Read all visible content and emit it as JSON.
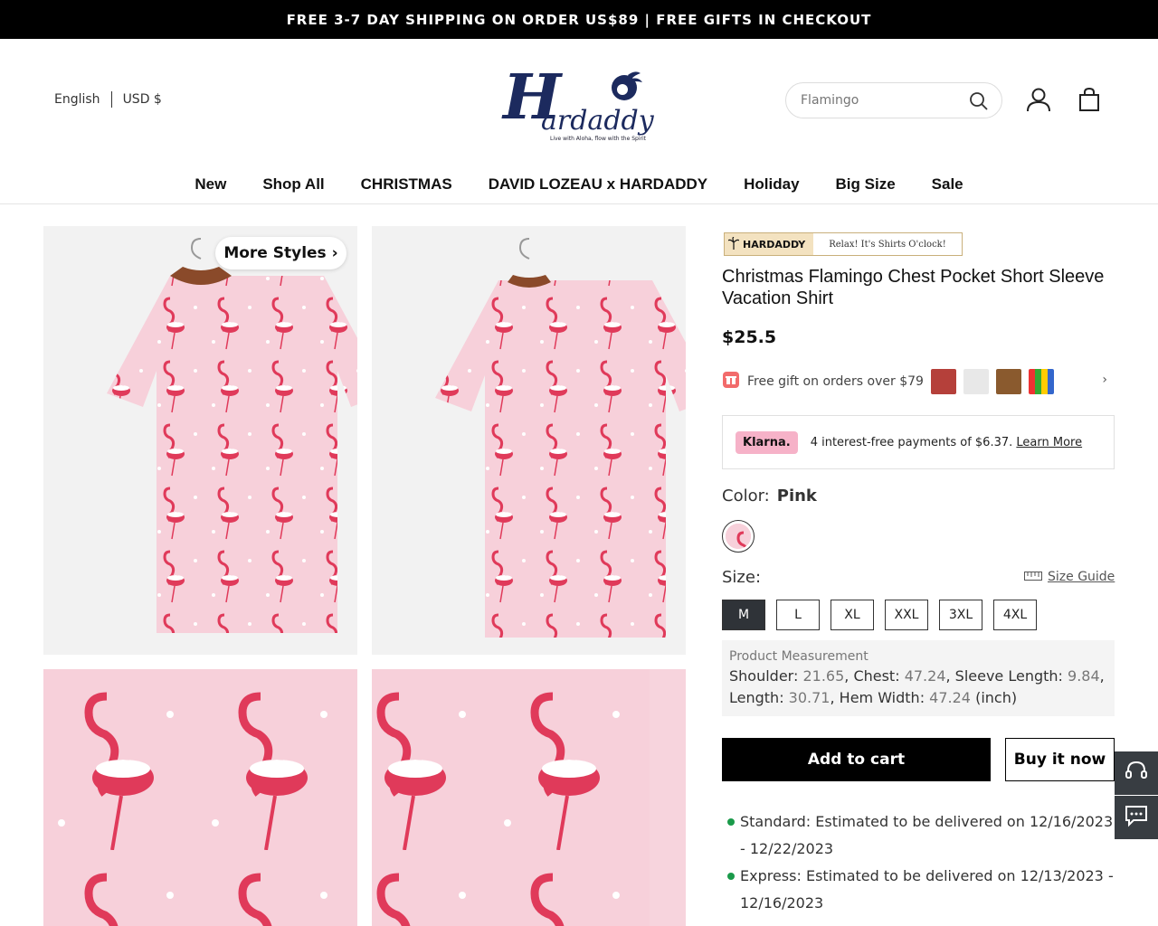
{
  "announcement": "FREE 3-7 DAY SHIPPING ON ORDER US$89 | FREE GIFTS IN CHECKOUT",
  "header": {
    "language": "English",
    "currency": "USD $",
    "logo_text": "Hardaddy",
    "logo_tagline": "Live with Aloha, flow with the Spirit",
    "search_placeholder": "Flamingo"
  },
  "nav": [
    "New",
    "Shop All",
    "CHRISTMAS",
    "DAVID LOZEAU x HARDADDY",
    "Holiday",
    "Big Size",
    "Sale"
  ],
  "gallery": {
    "more_styles": "More Styles"
  },
  "product": {
    "brand_banner_left": "HARDADDY",
    "brand_banner_right": "Relax! It's Shirts O'clock!",
    "title": "Christmas Flamingo Chest Pocket Short Sleeve Vacation Shirt",
    "price": "$25.5",
    "gift_text": "Free gift on orders over $79",
    "klarna": {
      "badge": "Klarna.",
      "text": "4 interest-free payments of $6.37.",
      "link": "Learn More"
    },
    "color_label": "Color:",
    "color_value": "Pink",
    "size_label": "Size:",
    "size_guide": "Size Guide",
    "sizes": [
      "M",
      "L",
      "XL",
      "XXL",
      "3XL",
      "4XL"
    ],
    "selected_size": "M",
    "measurement": {
      "heading": "Product Measurement",
      "shoulder_label": "Shoulder:",
      "shoulder": "21.65",
      "chest_label": "Chest:",
      "chest": "47.24",
      "sleeve_label": "Sleeve Length:",
      "sleeve": "9.84",
      "length_label": "Length:",
      "length": "30.71",
      "hem_label": "Hem Width:",
      "hem": "47.24",
      "unit": "(inch)"
    },
    "add_to_cart": "Add to cart",
    "buy_now": "Buy it now",
    "shipping": [
      "Standard: Estimated to be delivered on 12/16/2023 - 12/22/2023",
      "Express: Estimated to be delivered on 12/13/2023 - 12/16/2023"
    ]
  },
  "icons": {
    "search": "search-icon",
    "user": "user-icon",
    "cart": "shopping-bag-icon",
    "gift": "gift-icon",
    "ruler": "ruler-icon",
    "support": "headset-icon",
    "chat": "chat-icon"
  },
  "colors": {
    "accent_green": "#1a9a4a",
    "klarna_pink": "#f6b2c8",
    "shirt_pink": "#f7d4dd",
    "flamingo": "#e03a5a"
  }
}
